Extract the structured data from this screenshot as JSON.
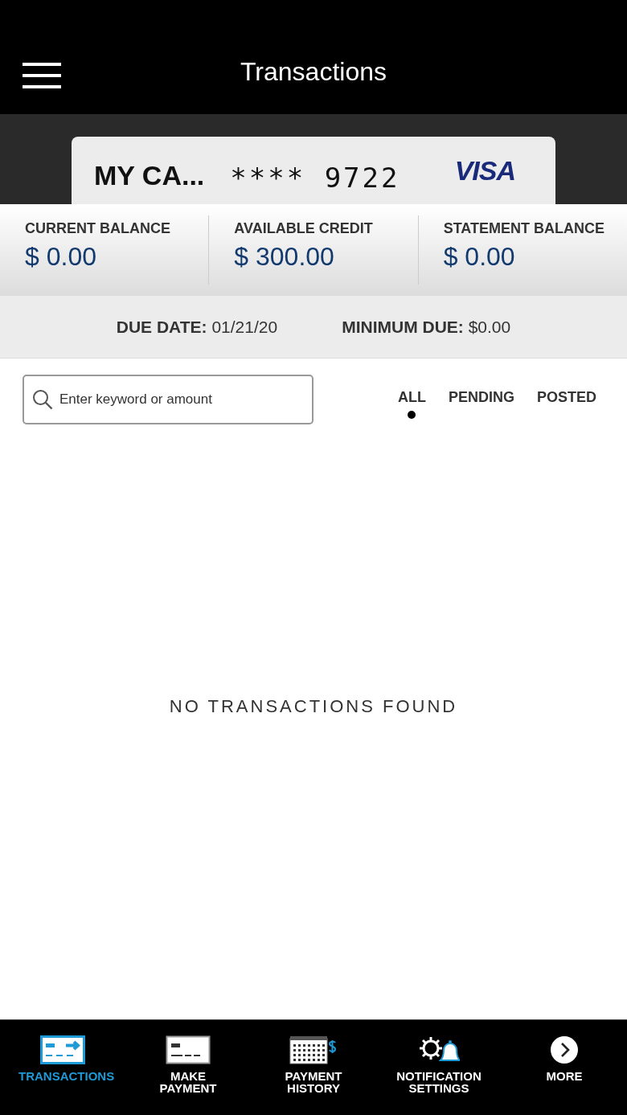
{
  "header": {
    "title": "Transactions"
  },
  "card": {
    "name": "MY CA...",
    "number": "**** 9722",
    "brand": "VISA"
  },
  "balances": [
    {
      "label": "CURRENT BALANCE",
      "amount": "$ 0.00"
    },
    {
      "label": "AVAILABLE CREDIT",
      "amount": "$ 300.00"
    },
    {
      "label": "STATEMENT BALANCE",
      "amount": "$ 0.00"
    }
  ],
  "due": [
    {
      "label": "DUE DATE:",
      "value": "01/21/20"
    },
    {
      "label": "MINIMUM DUE:",
      "value": "$0.00"
    }
  ],
  "search": {
    "placeholder": "Enter keyword or amount"
  },
  "filters": [
    {
      "label": "ALL",
      "selected": true
    },
    {
      "label": "PENDING",
      "selected": false
    },
    {
      "label": "POSTED",
      "selected": false
    }
  ],
  "empty_message": "NO TRANSACTIONS FOUND",
  "nav": [
    {
      "kind": "transactions",
      "label": "TRANSACTIONS",
      "selected": true
    },
    {
      "kind": "payment",
      "label": "MAKE PAYMENT",
      "selected": false
    },
    {
      "kind": "history",
      "label": "PAYMENT HISTORY",
      "selected": false
    },
    {
      "kind": "notifications",
      "label": "NOTIFICATION SETTINGS",
      "selected": false
    },
    {
      "kind": "more",
      "label": "MORE",
      "selected": false
    }
  ]
}
